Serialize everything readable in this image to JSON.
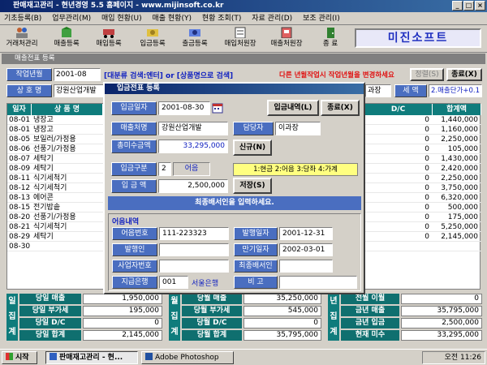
{
  "window": {
    "title": "판매재고관리 - 현년경영 5.5   홈페이지 - www.mijinsoft.co.kr"
  },
  "menu": [
    "기초등록(B)",
    "업무관리(M)",
    "매입 현황(U)",
    "매출 현황(Y)",
    "현황 조회(T)",
    "자료 관리(D)",
    "보조 관리(I)"
  ],
  "toolbar": {
    "buttons": [
      "거래처관리",
      "매출등록",
      "매입등록",
      "입금등록",
      "출금등록",
      "매입처원장",
      "매출처원장",
      "종 료"
    ],
    "brand": "미진소프트"
  },
  "child": {
    "title": "매출전표 등록",
    "work_year_label": "작업년월",
    "work_year_value": "2001-08",
    "search_hint": "[대분류 검색:엔터] or [상품명으로 검색]",
    "warning": "다른 년월작업시 작업년월을 변경하세요",
    "btn_sort": "정렬(S)",
    "btn_close": "종료(X)",
    "customer_label": "상 호 명",
    "customer_value": "강원산업개발",
    "right_partial": "과장",
    "tax_label": "세 액",
    "tax_value": "2.매출단가+0.1"
  },
  "grid": {
    "headers": [
      "일자",
      "상 품 명",
      "D/C",
      "합계액"
    ],
    "rows": [
      {
        "date": "08-01",
        "name": "냉장고",
        "dc": "0",
        "total": "1,440,000"
      },
      {
        "date": "08-01",
        "name": "냉장고",
        "dc": "0",
        "total": "1,160,000"
      },
      {
        "date": "08-05",
        "name": "보일러/가정용",
        "dc": "0",
        "total": "2,250,000"
      },
      {
        "date": "08-06",
        "name": "선풍기/가정용",
        "dc": "0",
        "total": "105,000"
      },
      {
        "date": "08-07",
        "name": "세탁기",
        "dc": "0",
        "total": "1,430,000"
      },
      {
        "date": "08-09",
        "name": "세탁기",
        "dc": "0",
        "total": "2,420,000"
      },
      {
        "date": "08-11",
        "name": "식기세척기",
        "dc": "0",
        "total": "2,250,000"
      },
      {
        "date": "08-12",
        "name": "식기세척기",
        "dc": "0",
        "total": "3,750,000"
      },
      {
        "date": "08-13",
        "name": "에어콘",
        "dc": "0",
        "total": "6,320,000"
      },
      {
        "date": "08-15",
        "name": "전기밥솥",
        "dc": "0",
        "total": "500,000"
      },
      {
        "date": "08-20",
        "name": "선풍기/가정용",
        "dc": "0",
        "total": "175,000"
      },
      {
        "date": "08-21",
        "name": "식기세척기",
        "dc": "0",
        "total": "5,250,000"
      },
      {
        "date": "08-29",
        "name": "세탁기",
        "dc": "0",
        "total": "2,145,000"
      },
      {
        "date": "08-30",
        "name": "",
        "dc": "",
        "total": ""
      }
    ]
  },
  "summary": {
    "daily": {
      "section": [
        "일",
        "집",
        "계"
      ],
      "labels": [
        "당일 매출",
        "당일 부가세",
        "당일 D/C",
        "당일 합계"
      ],
      "values": [
        "1,950,000",
        "195,000",
        "0",
        "2,145,000"
      ]
    },
    "monthly": {
      "section": [
        "월",
        "집",
        "계"
      ],
      "labels": [
        "당월 매출",
        "당월 부가세",
        "당월 D/C",
        "당월 합계"
      ],
      "values": [
        "35,250,000",
        "545,000",
        "0",
        "35,795,000"
      ]
    },
    "yearly": {
      "section": [
        "년",
        "집",
        "계"
      ],
      "labels": [
        "전월 이월",
        "금년 매출",
        "금년 입금",
        "현재 미수"
      ],
      "values": [
        "0",
        "35,795,000",
        "2,500,000",
        "33,295,000"
      ]
    }
  },
  "dialog": {
    "title": "입금전표 등록",
    "date_label": "입금일자",
    "date_value": "2001-08-30",
    "btn_history": "입금내역(L)",
    "btn_close": "종료(X)",
    "customer_label": "매출처명",
    "customer_value": "강원산업개발",
    "manager_label": "담당자",
    "manager_value": "이과장",
    "total_label": "총미수금액",
    "total_value": "33,295,000",
    "btn_new": "신규(N)",
    "type_label": "입금구분",
    "type_value": "2",
    "type_name": "어음",
    "type_hint": "1:현금  2:어음  3:당좌  4:가계",
    "amount_label": "입 금 액",
    "amount_value": "2,500,000",
    "btn_save": "저장(S)",
    "message": "최종배서인을 입력하세요.",
    "bill_section": "어음내역",
    "bill_no_label": "어음번호",
    "bill_no_value": "111-223323",
    "issue_date_label": "발행일자",
    "issue_date_value": "2001-12-31",
    "issuer_label": "발행인",
    "issuer_value": "",
    "due_date_label": "만기일자",
    "due_date_value": "2002-03-01",
    "biz_no_label": "사업자번호",
    "biz_no_value": "",
    "endorser_label": "최종배서인",
    "endorser_value": "",
    "bank_label": "지급은행",
    "bank_code": "001",
    "bank_name": "서울은행",
    "memo_label": "비 고",
    "memo_value": ""
  },
  "taskbar": {
    "start": "시작",
    "tasks": [
      "판매재고관리 - 현...",
      "Adobe Photoshop"
    ],
    "clock": "오전 11:26"
  }
}
